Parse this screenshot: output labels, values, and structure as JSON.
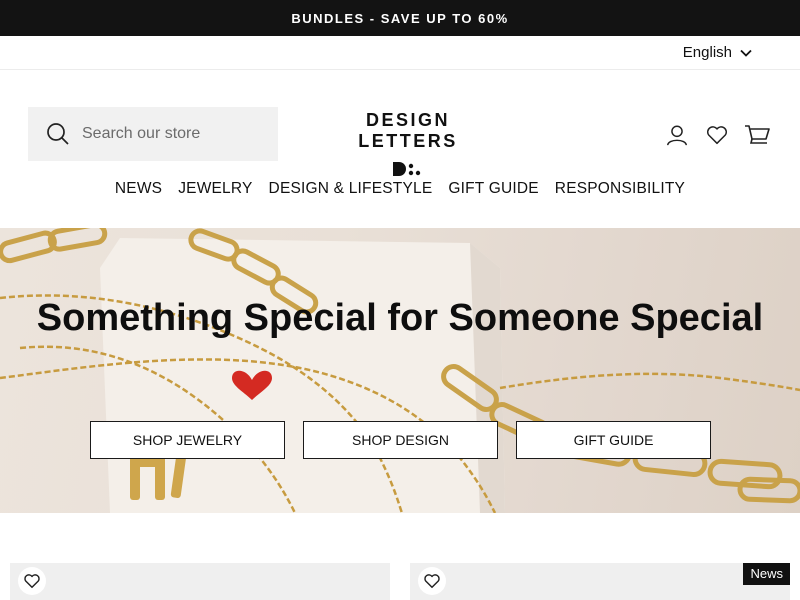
{
  "announcement": "BUNDLES - SAVE UP TO 60%",
  "language": {
    "selected": "English"
  },
  "search": {
    "placeholder": "Search our store"
  },
  "logo": {
    "wordmark": "DESIGN LETTERS"
  },
  "header_icons": [
    "account-icon",
    "heart-icon",
    "cart-icon"
  ],
  "nav": {
    "items": [
      {
        "label": "NEWS"
      },
      {
        "label": "JEWELRY"
      },
      {
        "label": "DESIGN & LIFESTYLE"
      },
      {
        "label": "GIFT GUIDE"
      },
      {
        "label": "RESPONSIBILITY"
      }
    ]
  },
  "hero": {
    "title": "Something Special for Someone Special",
    "buttons": [
      {
        "label": "SHOP JEWELRY"
      },
      {
        "label": "SHOP DESIGN"
      },
      {
        "label": "GIFT GUIDE"
      }
    ]
  },
  "products": {
    "badge": "News"
  },
  "colors": {
    "announcement_bg": "#131313",
    "search_bg": "#f1f1f1",
    "hero_bg": "#e9e0d7",
    "accent_gold": "#c9a24a",
    "heart_red": "#d42a22"
  }
}
